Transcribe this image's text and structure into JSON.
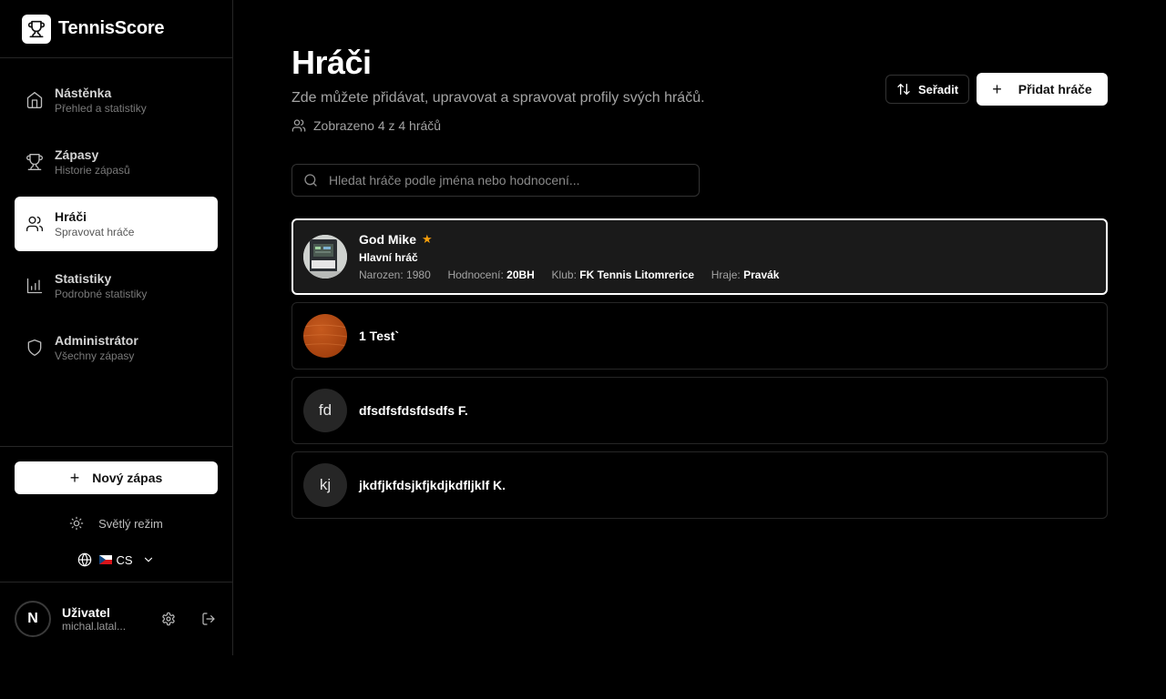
{
  "app": {
    "name": "TennisScore"
  },
  "sidebar": {
    "items": [
      {
        "title": "Nástěnka",
        "sub": "Přehled a statistiky",
        "icon": "home-icon"
      },
      {
        "title": "Zápasy",
        "sub": "Historie zápasů",
        "icon": "trophy-icon"
      },
      {
        "title": "Hráči",
        "sub": "Spravovat hráče",
        "icon": "users-icon",
        "active": true
      },
      {
        "title": "Statistiky",
        "sub": "Podrobné statistiky",
        "icon": "bar-chart-icon"
      },
      {
        "title": "Administrátor",
        "sub": "Všechny zápasy",
        "icon": "shield-icon"
      }
    ],
    "new_match": "Nový zápas",
    "theme_toggle": "Světlý režim",
    "language": "CS",
    "user": {
      "avatar_letter": "N",
      "name": "Uživatel",
      "email": "michal.latal..."
    }
  },
  "main": {
    "title": "Hráči",
    "subtitle": "Zde můžete přidávat, upravovat a spravovat profily svých hráčů.",
    "count": "Zobrazeno 4 z 4 hráčů",
    "sort_label": "Seřadit",
    "add_label": "Přidat hráče",
    "search_placeholder": "Hledat hráče podle jména nebo hodnocení...",
    "players": [
      {
        "name": "God Mike",
        "favorite": true,
        "role": "Hlavní hráč",
        "born_label": "Narozen:",
        "born": "1980",
        "rating_label": "Hodnocení:",
        "rating": "20BH",
        "club_label": "Klub:",
        "club": "FK Tennis Litomrerice",
        "plays_label": "Hraje:",
        "plays": "Pravák",
        "avatar_type": "photo"
      },
      {
        "name": "1 Test`",
        "avatar_type": "image-wood"
      },
      {
        "name": "dfsdfsfdsfdsdfs F.",
        "initials": "fd"
      },
      {
        "name": "jkdfjkfdsjkfjkdjkdfljklf K.",
        "initials": "kj"
      }
    ]
  },
  "colors": {
    "accent": "#ffffff",
    "star": "#f59e0b",
    "background": "#000000"
  }
}
